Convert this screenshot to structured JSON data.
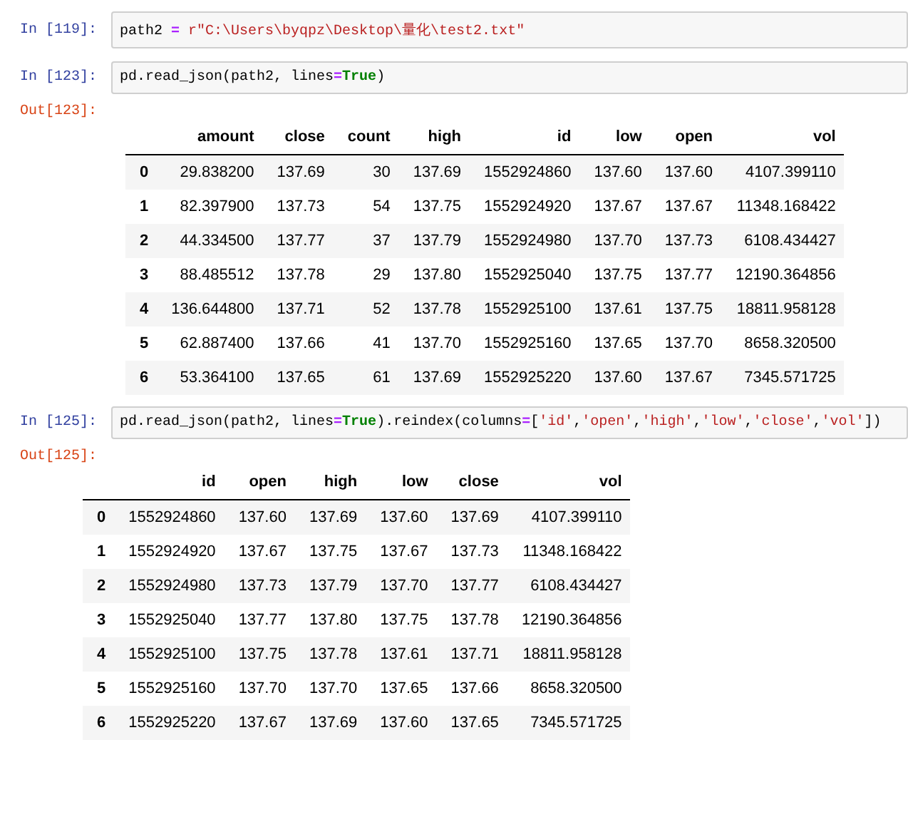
{
  "cells": [
    {
      "prompt": "In  [119]:",
      "code": [
        {
          "kind": "plain",
          "text": "path2 "
        },
        {
          "kind": "op",
          "text": "="
        },
        {
          "kind": "string",
          "text": "r\"C:\\Users\\byqpz\\Desktop\\量化\\test2.txt\""
        }
      ]
    },
    {
      "prompt": "In  [123]:",
      "code": [
        {
          "kind": "plain",
          "text": "pd.read_json(path2, lines"
        },
        {
          "kind": "op",
          "text": "="
        },
        {
          "kind": "keyword",
          "text": "True"
        },
        {
          "kind": "plain",
          "text": ")"
        }
      ],
      "output": {
        "prompt": "Out[123]:",
        "columns": [
          "",
          "amount",
          "close",
          "count",
          "high",
          "id",
          "low",
          "open",
          "vol"
        ],
        "rows": [
          [
            "0",
            "29.838200",
            "137.69",
            "30",
            "137.69",
            "1552924860",
            "137.60",
            "137.60",
            "4107.399110"
          ],
          [
            "1",
            "82.397900",
            "137.73",
            "54",
            "137.75",
            "1552924920",
            "137.67",
            "137.67",
            "11348.168422"
          ],
          [
            "2",
            "44.334500",
            "137.77",
            "37",
            "137.79",
            "1552924980",
            "137.70",
            "137.73",
            "6108.434427"
          ],
          [
            "3",
            "88.485512",
            "137.78",
            "29",
            "137.80",
            "1552925040",
            "137.75",
            "137.77",
            "12190.364856"
          ],
          [
            "4",
            "136.644800",
            "137.71",
            "52",
            "137.78",
            "1552925100",
            "137.61",
            "137.75",
            "18811.958128"
          ],
          [
            "5",
            "62.887400",
            "137.66",
            "41",
            "137.70",
            "1552925160",
            "137.65",
            "137.70",
            "8658.320500"
          ],
          [
            "6",
            "53.364100",
            "137.65",
            "61",
            "137.69",
            "1552925220",
            "137.60",
            "137.67",
            "7345.571725"
          ]
        ]
      }
    },
    {
      "prompt": "In  [125]:",
      "code": [
        {
          "kind": "plain",
          "text": "pd.read_json(path2, lines"
        },
        {
          "kind": "op",
          "text": "="
        },
        {
          "kind": "keyword",
          "text": "True"
        },
        {
          "kind": "plain",
          "text": ").reindex(columns"
        },
        {
          "kind": "op",
          "text": "="
        },
        {
          "kind": "plain",
          "text": "["
        },
        {
          "kind": "string",
          "text": "'id'"
        },
        {
          "kind": "plain",
          "text": ","
        },
        {
          "kind": "string",
          "text": "'open'"
        },
        {
          "kind": "plain",
          "text": ","
        },
        {
          "kind": "string",
          "text": "'high'"
        },
        {
          "kind": "plain",
          "text": ","
        },
        {
          "kind": "string",
          "text": "'low'"
        },
        {
          "kind": "plain",
          "text": ","
        },
        {
          "kind": "string",
          "text": "'close'"
        },
        {
          "kind": "plain",
          "text": ","
        },
        {
          "kind": "string",
          "text": "'vol'"
        },
        {
          "kind": "plain",
          "text": "])"
        }
      ],
      "output": {
        "prompt": "Out[125]:",
        "columns": [
          "",
          "id",
          "open",
          "high",
          "low",
          "close",
          "vol"
        ],
        "rows": [
          [
            "0",
            "1552924860",
            "137.60",
            "137.69",
            "137.60",
            "137.69",
            "4107.399110"
          ],
          [
            "1",
            "1552924920",
            "137.67",
            "137.75",
            "137.67",
            "137.73",
            "11348.168422"
          ],
          [
            "2",
            "1552924980",
            "137.73",
            "137.79",
            "137.70",
            "137.77",
            "6108.434427"
          ],
          [
            "3",
            "1552925040",
            "137.77",
            "137.80",
            "137.75",
            "137.78",
            "12190.364856"
          ],
          [
            "4",
            "1552925100",
            "137.75",
            "137.78",
            "137.61",
            "137.71",
            "18811.958128"
          ],
          [
            "5",
            "1552925160",
            "137.70",
            "137.70",
            "137.65",
            "137.66",
            "8658.320500"
          ],
          [
            "6",
            "1552925220",
            "137.67",
            "137.69",
            "137.60",
            "137.65",
            "7345.571725"
          ]
        ]
      }
    }
  ]
}
